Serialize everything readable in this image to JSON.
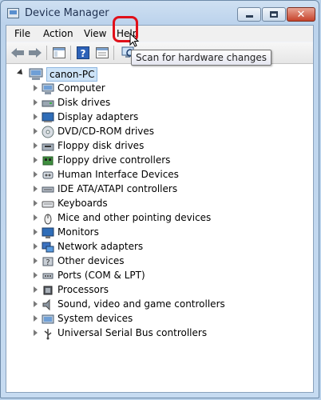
{
  "window": {
    "title": "Device Manager"
  },
  "menu": {
    "file": "File",
    "action": "Action",
    "view": "View",
    "help": "Help"
  },
  "tooltip": "Scan for hardware changes",
  "tree": {
    "root": "canon-PC",
    "items": [
      {
        "label": "Computer",
        "icon": "computer-icon"
      },
      {
        "label": "Disk drives",
        "icon": "disk-drive-icon"
      },
      {
        "label": "Display adapters",
        "icon": "display-adapter-icon"
      },
      {
        "label": "DVD/CD-ROM drives",
        "icon": "dvd-drive-icon"
      },
      {
        "label": "Floppy disk drives",
        "icon": "floppy-drive-icon"
      },
      {
        "label": "Floppy drive controllers",
        "icon": "floppy-controller-icon"
      },
      {
        "label": "Human Interface Devices",
        "icon": "hid-icon"
      },
      {
        "label": "IDE ATA/ATAPI controllers",
        "icon": "ide-controller-icon"
      },
      {
        "label": "Keyboards",
        "icon": "keyboard-icon"
      },
      {
        "label": "Mice and other pointing devices",
        "icon": "mouse-icon"
      },
      {
        "label": "Monitors",
        "icon": "monitor-icon"
      },
      {
        "label": "Network adapters",
        "icon": "network-adapter-icon"
      },
      {
        "label": "Other devices",
        "icon": "other-devices-icon"
      },
      {
        "label": "Ports (COM & LPT)",
        "icon": "ports-icon"
      },
      {
        "label": "Processors",
        "icon": "processor-icon"
      },
      {
        "label": "Sound, video and game controllers",
        "icon": "sound-icon"
      },
      {
        "label": "System devices",
        "icon": "system-devices-icon"
      },
      {
        "label": "Universal Serial Bus controllers",
        "icon": "usb-icon"
      }
    ]
  },
  "colors": {
    "highlight_ring": "#e0101a",
    "selection": "#cde3f7"
  }
}
